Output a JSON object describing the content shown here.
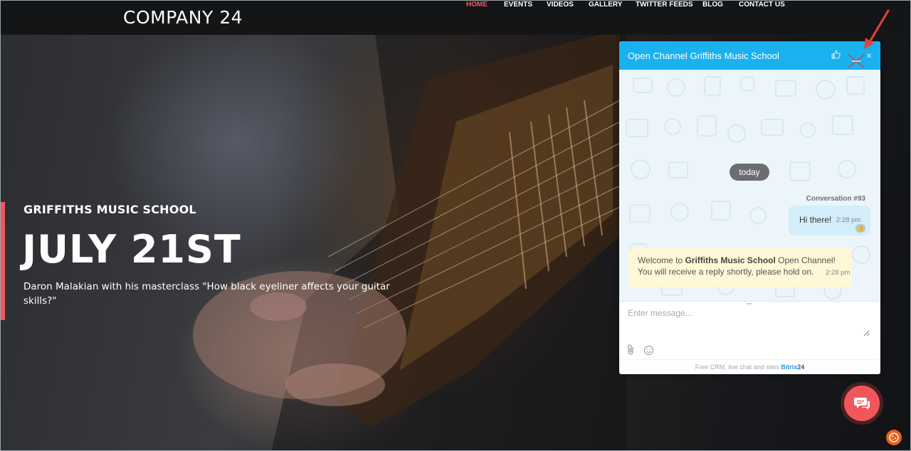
{
  "site": {
    "logo": "COMPANY 24",
    "nav": [
      "HOME",
      "EVENTS",
      "VIDEOS",
      "GALLERY",
      "TWITTER FEEDS",
      "BLOG",
      "CONTACT US"
    ],
    "active_nav": "HOME",
    "accent_color": "#f0575d"
  },
  "hero": {
    "eyebrow": "GRIFFITHS MUSIC SCHOOL",
    "title": "JULY 21ST",
    "description": "Daron Malakian with his masterclass \"How black eyeliner affects your guitar skills?\""
  },
  "chat": {
    "title": "Open Channel Griffiths Music School",
    "header_color": "#19b1ef",
    "header_icons": [
      "thumbs-up-icon",
      "minimize-icon",
      "close-icon"
    ],
    "date_separator": "today",
    "conversation_label": "Conversation #93",
    "messages": [
      {
        "direction": "out",
        "text": "Hi there!",
        "time": "2:28 pm"
      },
      {
        "direction": "in",
        "line1_prefix": "Welcome to ",
        "line1_bold": "Griffiths Music School",
        "line1_suffix": " Open Channel!",
        "line2": "You will receive a reply shortly, please hold on.",
        "time": "2:28 pm"
      }
    ],
    "input_placeholder": "Enter message...",
    "footer_text": "Free CRM, live chat and sites",
    "footer_brand": "Bitrix",
    "footer_brand_num": "24"
  }
}
